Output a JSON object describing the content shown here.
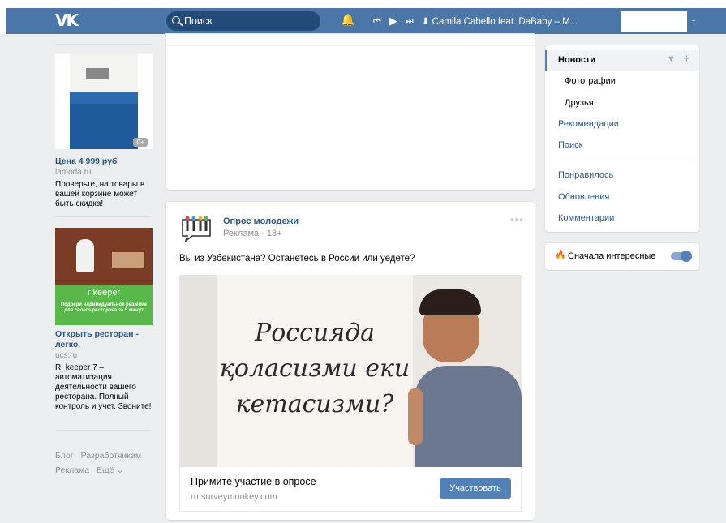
{
  "header": {
    "logo": "VK",
    "search_placeholder": "Поиск",
    "player": {
      "prev_icon": "prev-icon",
      "play_icon": "play-icon",
      "next_icon": "next-icon",
      "track": "Camila Cabello feat. DaBaby – M..."
    }
  },
  "left_ads": [
    {
      "title": "Цена 4 999 руб",
      "domain": "lamoda.ru",
      "text": "Проверьте, на товары в вашей корзине может быть скидка!",
      "image_badge": "0+"
    },
    {
      "title": "Открыть ресторан - легко.",
      "domain": "ucs.ru",
      "text": "R_keeper 7 – автоматизация деятельности вашего ресторана. Полный контроль и учет. Звоните!",
      "banner_brand": "r keeper",
      "banner_text": "Подбери индивидуальное решение для своего ресторана за 5 минут"
    }
  ],
  "footer": {
    "links": [
      "Блог",
      "Разработчикам",
      "Реклама",
      "Ещё ⌄"
    ]
  },
  "post": {
    "author": "Опрос молодежи",
    "meta": "Реклама · 18+",
    "text": "Вы из Узбекистана? Останетесь в России или уедете?",
    "image_text_lines": [
      "Россиядa",
      "қоласизми еки",
      "кетасизми?"
    ],
    "cta_title": "Примите участие в опросе",
    "cta_domain": "ru.surveymonkey.com",
    "cta_button": "Участвовать"
  },
  "menu": {
    "items": [
      {
        "label": "Новости",
        "active": true
      },
      {
        "label": "Фотографии",
        "sub": true
      },
      {
        "label": "Друзья",
        "sub": true
      },
      {
        "label": "Рекомендации"
      },
      {
        "label": "Поиск"
      },
      {
        "label": "Понравилось"
      },
      {
        "label": "Обновления"
      },
      {
        "label": "Комментарии"
      }
    ]
  },
  "toggle": {
    "label": "Сначала интересные",
    "on": true
  },
  "colors": {
    "brand": "#4a76a8",
    "link": "#2a5885",
    "button": "#5181b8"
  }
}
